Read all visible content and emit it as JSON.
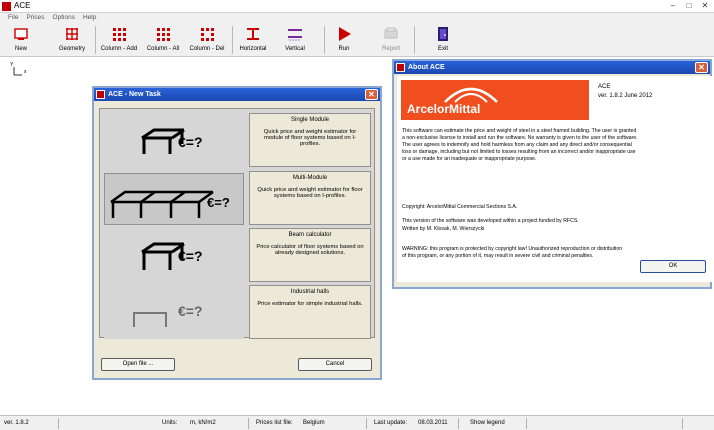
{
  "app": {
    "title": "ACE"
  },
  "menu": [
    "File",
    "Prices",
    "Options",
    "Help"
  ],
  "toolbar": {
    "new": "New",
    "geometry": "Geometry",
    "column_add": "Column - Add",
    "column_all": "Column - All",
    "column_del": "Column - Del",
    "horizontal": "Horizontal",
    "vertical": "Vertical",
    "run": "Run",
    "report": "Report",
    "exit": "Exit"
  },
  "axes": {
    "y": "Y",
    "x": "x"
  },
  "colors": {
    "accent": "#f04e1e",
    "titlebar": "#2a62d8",
    "danger": "#cc0000"
  },
  "new_task": {
    "title": "ACE - New Task",
    "options": [
      {
        "name": "Single Module",
        "desc": "Quick price and weight estimator for module of floor systems based on I-profiles.",
        "symbol": "€=?"
      },
      {
        "name": "Multi-Module",
        "desc": "Quick price and weight estimator for floor systems based on I-profiles.",
        "symbol": "€=?"
      },
      {
        "name": "Beam calculator",
        "desc": "Price calculator of floor systems based on already designed solutions.",
        "symbol": "€=?"
      },
      {
        "name": "Industrial halls",
        "desc": "Price estimator for simple industrial halls.",
        "symbol": "€=?"
      }
    ],
    "open_file": "Open file ...",
    "cancel": "Cancel"
  },
  "about": {
    "title": "About ACE",
    "logo": "ArcelorMittal",
    "app_name": "ACE",
    "version": "ver. 1.8.2 June 2012",
    "p1": "This software can estimate the price and weight of steel in a steel framed building. The user is granted a non-exclusive license to install and run the software. No warranty is given to the user of the software. The user agrees to indemnify and hold harmless from any claim and any direct and/or consequential loss or damage, including but not limited to losses resulting from an incorrect and/or inappropriate use or a use made for an inadequate or inappropriate purpose.",
    "copyright": "Copyright: ArcelorMittal Commercial Sections S.A.",
    "rfcs": "This version of the software was developed within a project funded by RFCS.",
    "authors": "Written by M. Klosak, M. Wierszycki",
    "warning": "WARNING: this program is protected by copyright law! Unauthorized reproduction or distribution of this program, or any portion of it, may result in severe civil and criminal penalties.",
    "ok": "OK"
  },
  "status": {
    "version": "ver. 1.8.2",
    "units_label": "Units:",
    "units_value": "m, kN/m2",
    "prices_label": "Prices list file:",
    "prices_value": "Belgium",
    "update_label": "Last update:",
    "update_value": "08.03.2011",
    "legend": "Show legend"
  }
}
